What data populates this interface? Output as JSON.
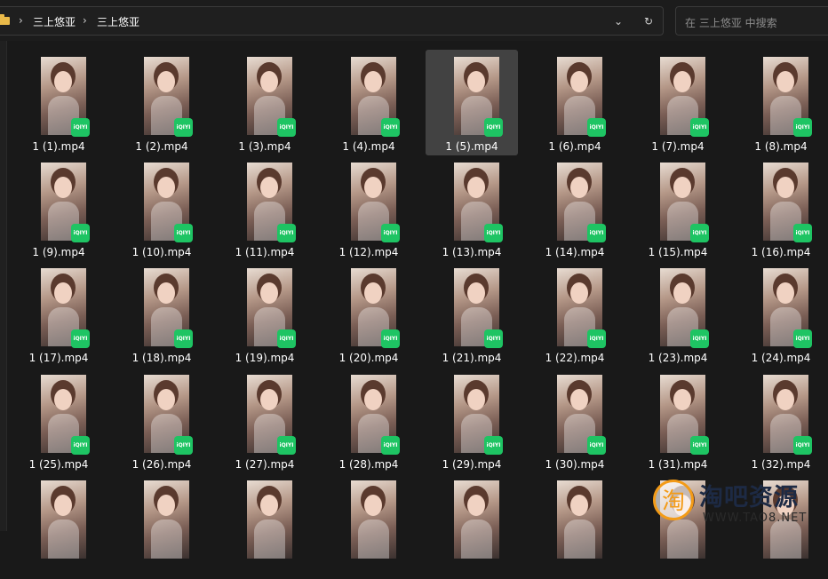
{
  "address_bar": {
    "breadcrumbs": [
      "三上悠亚",
      "三上悠亚"
    ],
    "separator": "›",
    "dropdown_icon": "chevron-down-icon",
    "refresh_icon": "refresh-icon"
  },
  "search": {
    "placeholder": "在 三上悠亚 中搜索"
  },
  "files": [
    {
      "name": "1 (1).mp4"
    },
    {
      "name": "1 (2).mp4"
    },
    {
      "name": "1 (3).mp4"
    },
    {
      "name": "1 (4).mp4"
    },
    {
      "name": "1 (5).mp4",
      "selected": true
    },
    {
      "name": "1 (6).mp4"
    },
    {
      "name": "1 (7).mp4"
    },
    {
      "name": "1 (8).mp4"
    },
    {
      "name": "1 (9).mp4"
    },
    {
      "name": "1 (10).mp4"
    },
    {
      "name": "1 (11).mp4"
    },
    {
      "name": "1 (12).mp4"
    },
    {
      "name": "1 (13).mp4"
    },
    {
      "name": "1 (14).mp4"
    },
    {
      "name": "1 (15).mp4"
    },
    {
      "name": "1 (16).mp4"
    },
    {
      "name": "1 (17).mp4"
    },
    {
      "name": "1 (18).mp4"
    },
    {
      "name": "1 (19).mp4"
    },
    {
      "name": "1 (20).mp4"
    },
    {
      "name": "1 (21).mp4"
    },
    {
      "name": "1 (22).mp4"
    },
    {
      "name": "1 (23).mp4"
    },
    {
      "name": "1 (24).mp4"
    },
    {
      "name": "1 (25).mp4"
    },
    {
      "name": "1 (26).mp4"
    },
    {
      "name": "1 (27).mp4"
    },
    {
      "name": "1 (28).mp4"
    },
    {
      "name": "1 (29).mp4"
    },
    {
      "name": "1 (30).mp4"
    },
    {
      "name": "1 (31).mp4"
    },
    {
      "name": "1 (32).mp4"
    },
    {
      "name": ""
    },
    {
      "name": ""
    },
    {
      "name": ""
    },
    {
      "name": ""
    },
    {
      "name": ""
    },
    {
      "name": ""
    },
    {
      "name": ""
    },
    {
      "name": ""
    }
  ],
  "file_badge": {
    "label": "iQIYI",
    "color": "#1ec463",
    "icon": "iqiyi-badge-icon"
  },
  "watermark": {
    "brand": "淘吧资源",
    "url": "WWW.TAO8.NET",
    "mark": "淘"
  },
  "colors": {
    "background": "#191919",
    "selection": "#424242",
    "folder": "#e9b949"
  }
}
